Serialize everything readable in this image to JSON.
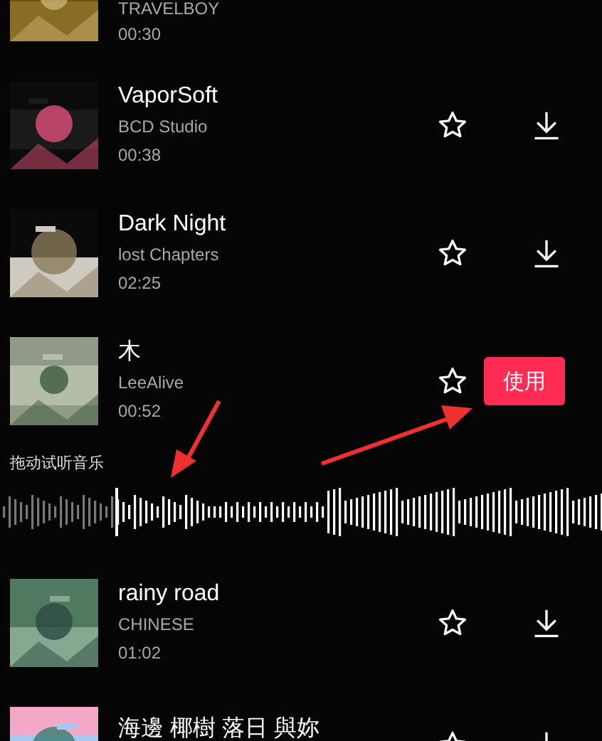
{
  "tracks": [
    {
      "artist": "TRAVELBOY",
      "duration": "00:30",
      "selected": false
    },
    {
      "title": "VaporSoft",
      "artist": "BCD Studio",
      "duration": "00:38",
      "favorite": false,
      "selected": false
    },
    {
      "title": "Dark Night",
      "artist": "lost Chapters",
      "duration": "02:25",
      "favorite": false,
      "selected": false
    },
    {
      "title": "木",
      "artist": "LeeAlive",
      "duration": "00:52",
      "favorite": false,
      "selected": true,
      "use_label": "使用",
      "preview": {
        "label": "拖动试听音乐"
      }
    },
    {
      "title": "rainy road",
      "artist": "CHINESE",
      "duration": "01:02",
      "favorite": false,
      "selected": false
    },
    {
      "title": "海邊 椰樹 落日 與妳",
      "favorite": false,
      "selected": false
    }
  ]
}
